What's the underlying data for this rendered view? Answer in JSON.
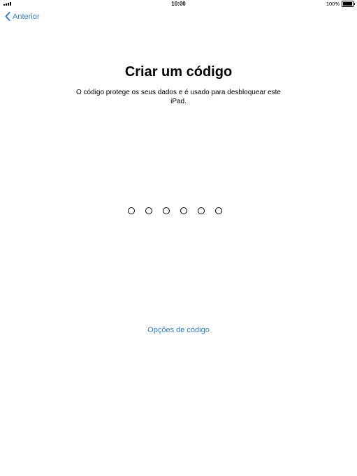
{
  "status_bar": {
    "time": "10:00",
    "battery_percent": "100%",
    "signal_icon": "cellular-signal-icon",
    "battery_icon": "battery-icon"
  },
  "nav": {
    "back_label": "Anterior",
    "back_icon": "chevron-left-icon"
  },
  "main": {
    "title": "Criar um código",
    "subtitle": "O código protege os seus dados e é usado para desbloquear este iPad.",
    "passcode_length": 6,
    "options_link": "Opções de código"
  },
  "colors": {
    "accent": "#2f7fd1",
    "text": "#000000",
    "background": "#ffffff"
  }
}
